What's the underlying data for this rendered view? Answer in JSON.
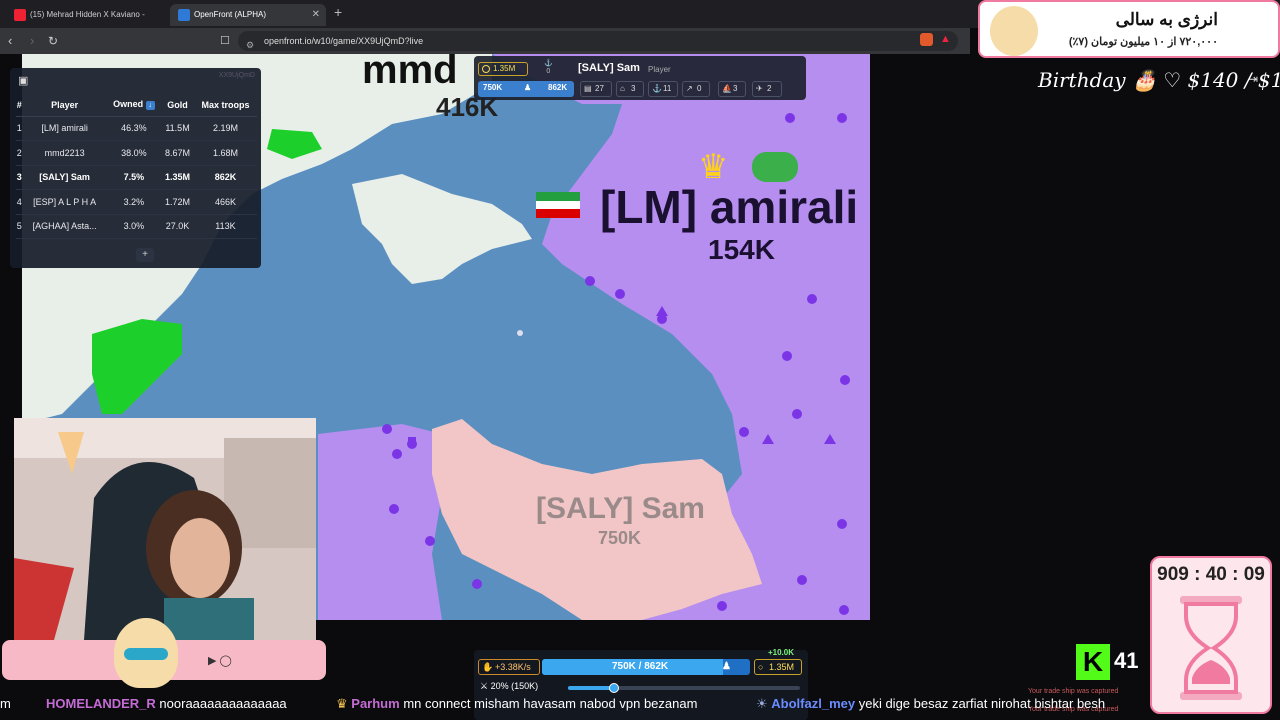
{
  "browser": {
    "tabs": [
      {
        "label": "(15) Mehrad Hidden X Kaviano -",
        "active": false
      },
      {
        "label": "OpenFront (ALPHA)",
        "active": true
      }
    ],
    "url": "openfront.io/w10/game/XX9UjQmD?live"
  },
  "map_labels": {
    "top_name": "mmd",
    "top_troops": "416K",
    "main_name": "[LM] amirali",
    "main_troops": "154K",
    "self_name": "[SALY] Sam",
    "self_troops": "750K"
  },
  "leaderboard": {
    "game_id": "XX9UjQmD",
    "headers": [
      "#",
      "Player",
      "Owned",
      "Gold",
      "Max troops"
    ],
    "rows": [
      {
        "rank": "1",
        "player": "[LM] amirali",
        "owned": "46.3%",
        "gold": "11.5M",
        "max_troops": "2.19M",
        "is_self": false
      },
      {
        "rank": "2",
        "player": "mmd2213",
        "owned": "38.0%",
        "gold": "8.67M",
        "max_troops": "1.68M",
        "is_self": false
      },
      {
        "rank": "3",
        "player": "[SALY] Sam",
        "owned": "7.5%",
        "gold": "1.35M",
        "max_troops": "862K",
        "is_self": true
      },
      {
        "rank": "4",
        "player": "[ESP] A L P H A",
        "owned": "3.2%",
        "gold": "1.72M",
        "max_troops": "466K",
        "is_self": false
      },
      {
        "rank": "5",
        "player": "[AGHAA] Asta...",
        "owned": "3.0%",
        "gold": "27.0K",
        "max_troops": "113K",
        "is_self": false
      }
    ],
    "expand_label": "+"
  },
  "player_info": {
    "gold": "1.35M",
    "boats": "0",
    "name": "[SALY] Sam",
    "role": "Player",
    "troops": "750K",
    "max_troops": "862K",
    "stats": [
      {
        "icon": "city-icon",
        "glyph": "▤",
        "value": "27"
      },
      {
        "icon": "port-icon",
        "glyph": "⌂",
        "value": "3"
      },
      {
        "icon": "anchor-icon",
        "glyph": "⚓",
        "value": "11"
      },
      {
        "icon": "missile-icon",
        "glyph": "↗",
        "value": "0"
      },
      {
        "icon": "warship-icon",
        "glyph": "⛵",
        "value": "3"
      },
      {
        "icon": "plane-icon",
        "glyph": "✈",
        "value": "2"
      }
    ]
  },
  "control_panel": {
    "gold_bonus": "+10.0K",
    "troop_rate": "+3.38K/s",
    "troops_text": "750K / 862K",
    "troops_fraction": 0.87,
    "gold": "1.35M",
    "attack_ratio_text": "20% (150K)",
    "attack_ratio": 0.2
  },
  "overlay": {
    "promo_title": "انرژی به سالی",
    "promo_sub": "۷۲۰,۰۰۰ از ۱۰ میلیون تومان (۷٪)",
    "birthday": "Birthday 🎂 ♡ $140 / $1",
    "timer": "909 : 40 : 09",
    "kick_logo": "K",
    "kick_viewers": "41",
    "notification": "Your trade ship was captured"
  },
  "chat": [
    {
      "user": "",
      "message": "m",
      "color": "#ffffff"
    },
    {
      "user": "HOMELANDER_R",
      "message": "nooraaaaaaaaaaaaaa",
      "color": "#c46cd4"
    },
    {
      "user": "Parhum",
      "message": "mn connect misham havasam nabod vpn bezanam",
      "color": "#c46cd4"
    },
    {
      "user": "Abolfazl_mey",
      "message": "yeki dige besaz zarfiat nirohat bishtar besh",
      "color": "#6a8cff"
    }
  ],
  "colors": {
    "ocean": "#5b8fbf",
    "purple_territory": "#b58ef0",
    "self_territory": "#f2c6c6",
    "neutral_land": "#e8efe9",
    "green_territory": "#1ccf2a",
    "accent_blue": "#3ba7ef",
    "gold": "#ffdd55"
  }
}
